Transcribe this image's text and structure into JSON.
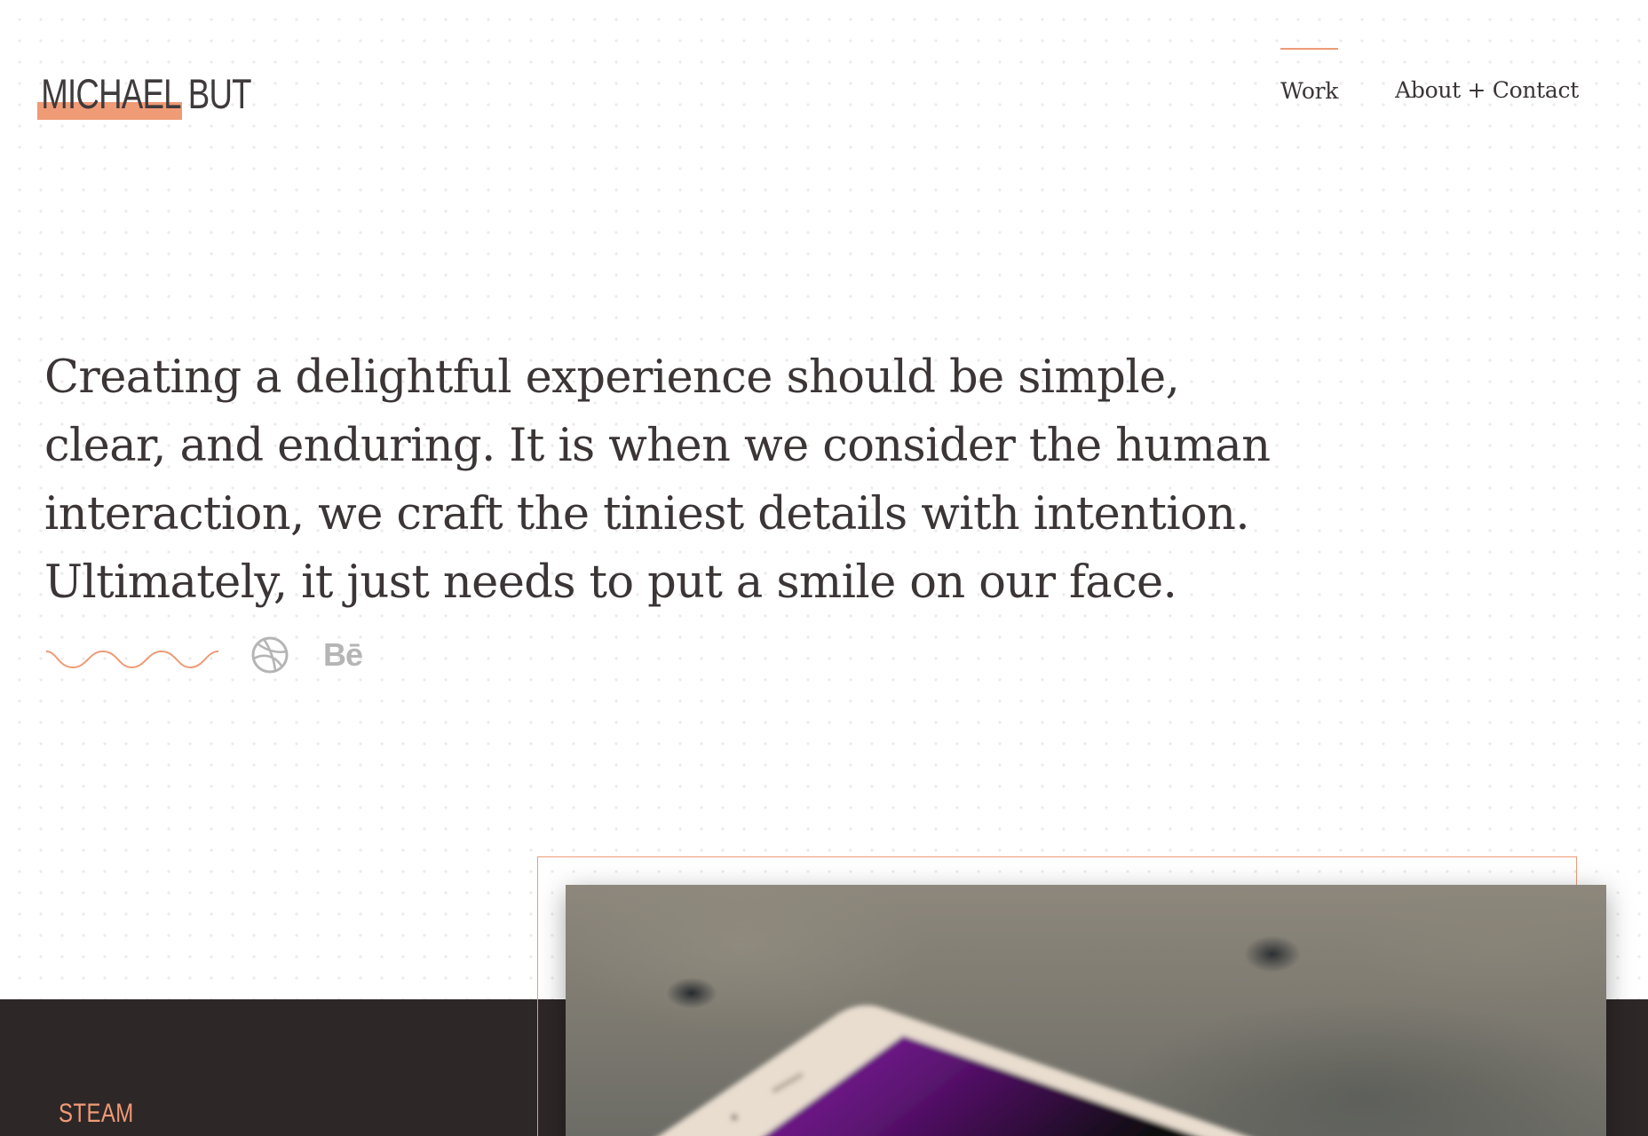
{
  "header": {
    "logo": "MICHAEL BUT",
    "nav": [
      {
        "label": "Work",
        "active": true
      },
      {
        "label": "About + Contact",
        "active": false
      }
    ]
  },
  "hero": {
    "statement": "Creating a delightful experience should be simple, clear, and enduring. It is when we consider the human interaction, we craft the tiniest details with intention. Ultimately, it just needs to put a smile on our face."
  },
  "social": {
    "icons": [
      "wave-icon",
      "dribbble-icon",
      "behance-icon"
    ],
    "behance_label": "Bē"
  },
  "project": {
    "label": "STEAM",
    "image": "phone-on-stone-image"
  },
  "colors": {
    "accent": "#ef9b76",
    "dark": "#2e2728",
    "text": "#3b3536"
  }
}
